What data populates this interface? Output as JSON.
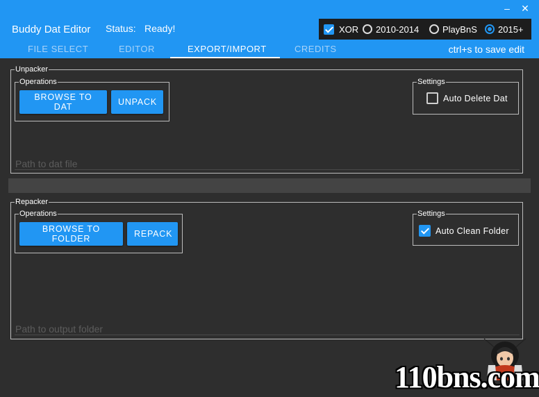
{
  "window": {
    "minimize_glyph": "–",
    "close_glyph": "✕"
  },
  "header": {
    "app_title": "Buddy Dat Editor",
    "status_label": "Status:",
    "status_value": "Ready!",
    "options": {
      "xor": {
        "label": "XOR",
        "checked": true
      },
      "versions": [
        {
          "label": "2010-2014",
          "selected": false
        },
        {
          "label": "PlayBnS",
          "selected": false
        },
        {
          "label": "2015+",
          "selected": true
        }
      ]
    },
    "hint": "ctrl+s to save edit"
  },
  "tabs": [
    {
      "label": "FILE SELECT",
      "active": false
    },
    {
      "label": "EDITOR",
      "active": false
    },
    {
      "label": "EXPORT/IMPORT",
      "active": true
    },
    {
      "label": "CREDITS",
      "active": false
    }
  ],
  "unpacker": {
    "legend": "Unpacker",
    "operations_legend": "Operations",
    "browse_label": "BROWSE TO DAT",
    "action_label": "UNPACK",
    "settings_legend": "Settings",
    "setting_label": "Auto Delete Dat",
    "setting_checked": false,
    "path_placeholder": "Path to dat file",
    "path_value": ""
  },
  "repacker": {
    "legend": "Repacker",
    "operations_legend": "Operations",
    "browse_label": "BROWSE TO FOLDER",
    "action_label": "REPACK",
    "settings_legend": "Settings",
    "setting_label": "Auto Clean Folder",
    "setting_checked": true,
    "path_placeholder": "Path to output folder",
    "path_value": ""
  },
  "watermark": {
    "text": "110bns.com"
  },
  "colors": {
    "accent": "#2196f3",
    "background": "#2e2e2e",
    "options_bar": "#1d1d1d"
  }
}
